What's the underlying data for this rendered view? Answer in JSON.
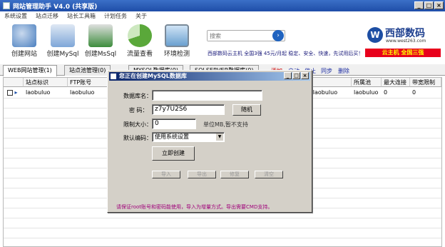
{
  "app": {
    "title": "网站管理助手 V4.0 (共享版)"
  },
  "menu": [
    "系统设置",
    "站点迁移",
    "站长工具箱",
    "计划任务",
    "关于"
  ],
  "toolbar": {
    "items": [
      {
        "label": "创建网站",
        "icon": "tools-icon",
        "color": "#4a7fbf"
      },
      {
        "label": "创建MySql",
        "icon": "database-icon",
        "color": "#7ea7d8"
      },
      {
        "label": "创建MsSql",
        "icon": "database-icon",
        "color": "#3c8c3c"
      },
      {
        "label": "流量查看",
        "icon": "pie-chart-icon",
        "color": "#5aa83a"
      },
      {
        "label": "环境检测",
        "icon": "monitor-icon",
        "color": "#6aa0d0"
      }
    ],
    "search_placeholder": "搜索",
    "ad_text": "西部数码云主机 全国3强 45元/月起 稳定、安全、快速，先试用后买！",
    "logo_text": "西部数码",
    "logo_url": "www.west263.com",
    "ad_banner": "云主机 全国三强"
  },
  "tabs": [
    "WEB网站管理(1)",
    "站点池管理(0)",
    "MYSQL数据库(0)",
    "SQLSERVER数据库(0)"
  ],
  "tab_links": [
    "添加",
    "启动",
    "停止",
    "同步",
    "删除"
  ],
  "grid": {
    "headers": [
      "",
      "站点标识",
      "FTP账号",
      "",
      "",
      "",
      "",
      "所属池",
      "最大连接",
      "带宽限制"
    ],
    "row": {
      "site_id": "laobuluo",
      "ftp": "laobuluo",
      "path": "root\\laobuluo",
      "pool": "laobuluo",
      "max_conn": "0",
      "bandwidth": "0"
    }
  },
  "dialog": {
    "title": "您正在创建MySQL数据库",
    "db_name_label": "数据库名：",
    "db_name_value": "",
    "password_label": "密 码：",
    "password_value": "z7y7U2S6",
    "random_button": "随机",
    "size_limit_label": "限制大小：",
    "size_limit_value": "0",
    "size_hint": "单位MB,暂不支持",
    "encoding_label": "默认编码：",
    "encoding_value": "使用系统设置",
    "create_button": "立即创建",
    "import_button": "导入",
    "export_button": "导出",
    "repair_button": "修复",
    "clear_button": "清空",
    "note": "请保证root账号和密码能使用，导入为增量方式。导出需要CMD支持。"
  }
}
